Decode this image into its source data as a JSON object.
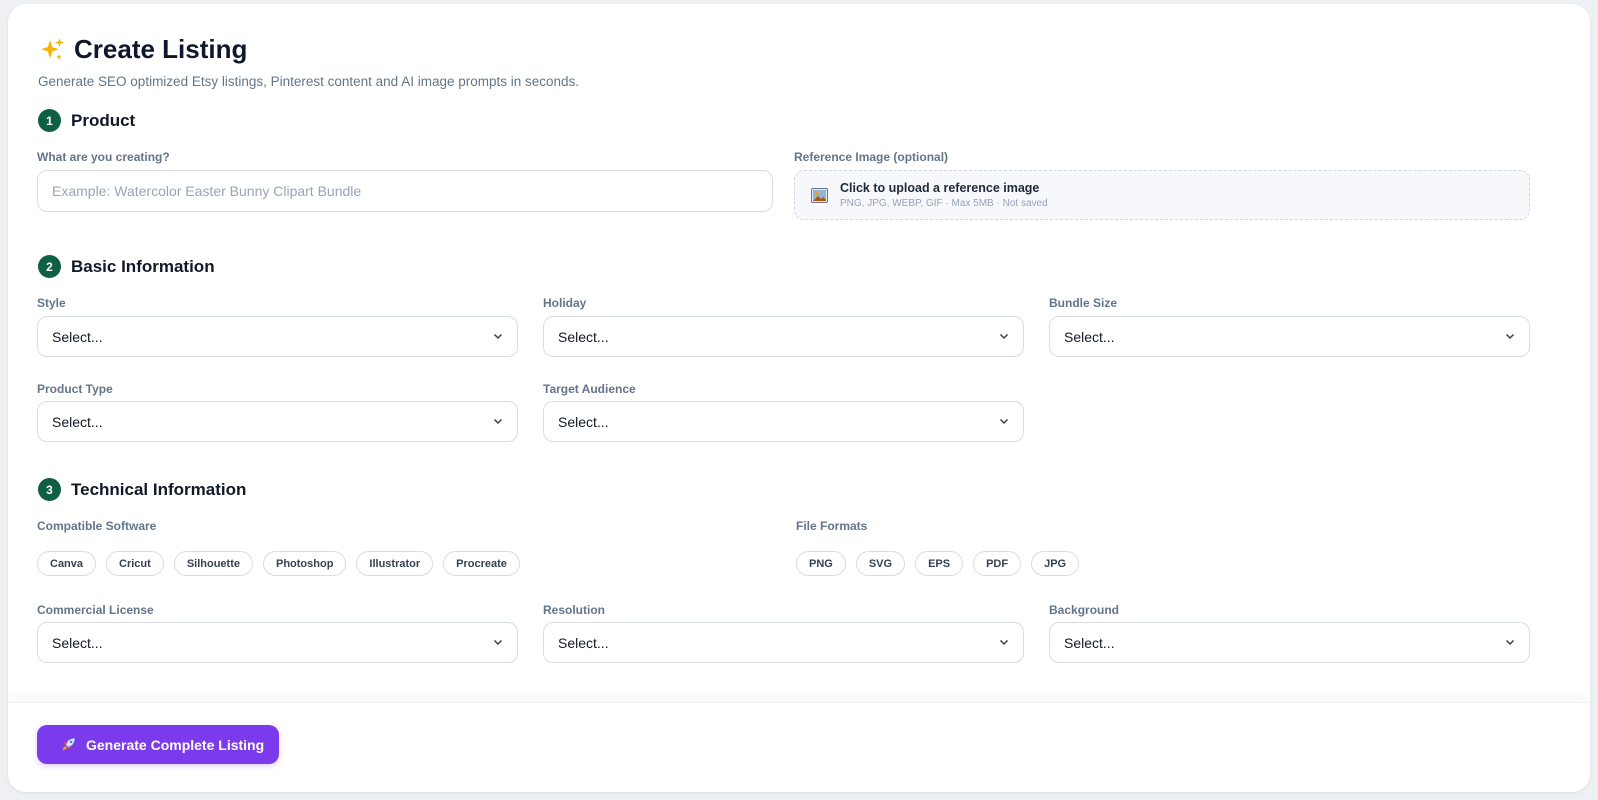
{
  "header": {
    "title": "Create Listing",
    "subtitle": "Generate SEO optimized Etsy listings, Pinterest content and AI image prompts in seconds."
  },
  "sections": {
    "product": {
      "step": "1",
      "title": "Product"
    },
    "basic": {
      "step": "2",
      "title": "Basic Information"
    },
    "technical": {
      "step": "3",
      "title": "Technical Information"
    }
  },
  "product": {
    "name_label": "What are you creating?",
    "name_placeholder": "Example: Watercolor Easter Bunny Clipart Bundle",
    "name_value": "",
    "image_label": "Reference Image (optional)",
    "upload_title": "Click to upload a reference image",
    "upload_hint": "PNG, JPG, WEBP, GIF · Max 5MB · Not saved"
  },
  "basic": {
    "style": {
      "label": "Style",
      "value": "Select..."
    },
    "holiday": {
      "label": "Holiday",
      "value": "Select..."
    },
    "bundle_size": {
      "label": "Bundle Size",
      "value": "Select..."
    },
    "product_type": {
      "label": "Product Type",
      "value": "Select..."
    },
    "target_audience": {
      "label": "Target Audience",
      "value": "Select..."
    }
  },
  "technical": {
    "software_label": "Compatible Software",
    "software": [
      "Canva",
      "Cricut",
      "Silhouette",
      "Photoshop",
      "Illustrator",
      "Procreate"
    ],
    "formats_label": "File Formats",
    "formats": [
      "PNG",
      "SVG",
      "EPS",
      "PDF",
      "JPG"
    ],
    "license": {
      "label": "Commercial License",
      "value": "Select..."
    },
    "resolution": {
      "label": "Resolution",
      "value": "Select..."
    },
    "background": {
      "label": "Background",
      "value": "Select..."
    }
  },
  "footer": {
    "generate_label": "Generate Complete Listing"
  },
  "colors": {
    "accent": "#7c3aed",
    "step_badge": "#0f5f45",
    "muted_text": "#64748b"
  },
  "icons": {
    "title": "sparkles-icon",
    "upload": "image-icon",
    "select": "chevron-down-icon",
    "generate": "rocket-icon"
  }
}
